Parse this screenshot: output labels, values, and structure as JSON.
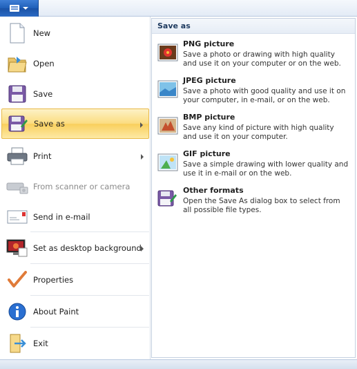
{
  "menu": {
    "items": [
      {
        "label": "New",
        "icon": "new-document-icon"
      },
      {
        "label": "Open",
        "icon": "open-folder-icon"
      },
      {
        "label": "Save",
        "icon": "save-floppy-icon"
      },
      {
        "label": "Save as",
        "icon": "save-as-icon"
      },
      {
        "label": "Print",
        "icon": "printer-icon"
      },
      {
        "label": "From scanner or camera",
        "icon": "scanner-camera-icon"
      },
      {
        "label": "Send in e-mail",
        "icon": "email-icon"
      },
      {
        "label": "Set as desktop background",
        "icon": "desktop-background-icon"
      },
      {
        "label": "Properties",
        "icon": "properties-checkmark-icon"
      },
      {
        "label": "About Paint",
        "icon": "info-icon"
      },
      {
        "label": "Exit",
        "icon": "exit-icon"
      }
    ]
  },
  "submenu": {
    "title": "Save as",
    "formats": [
      {
        "title": "PNG picture",
        "description": "Save a photo or drawing with high quality and use it on your computer or on the web.",
        "icon": "png-picture-icon"
      },
      {
        "title": "JPEG picture",
        "description": "Save a photo with good quality and use it on your computer, in e-mail, or on the web.",
        "icon": "jpeg-picture-icon"
      },
      {
        "title": "BMP picture",
        "description": "Save any kind of picture with high quality and use it on your computer.",
        "icon": "bmp-picture-icon"
      },
      {
        "title": "GIF picture",
        "description": "Save a simple drawing with lower quality and use it in e-mail or on the web.",
        "icon": "gif-picture-icon"
      },
      {
        "title": "Other formats",
        "description": "Open the Save As dialog box to select from all possible file types.",
        "icon": "other-formats-icon"
      }
    ]
  },
  "colors": {
    "selected_highlight": "#fbdc7f",
    "app_button": "#2b6ac4"
  }
}
